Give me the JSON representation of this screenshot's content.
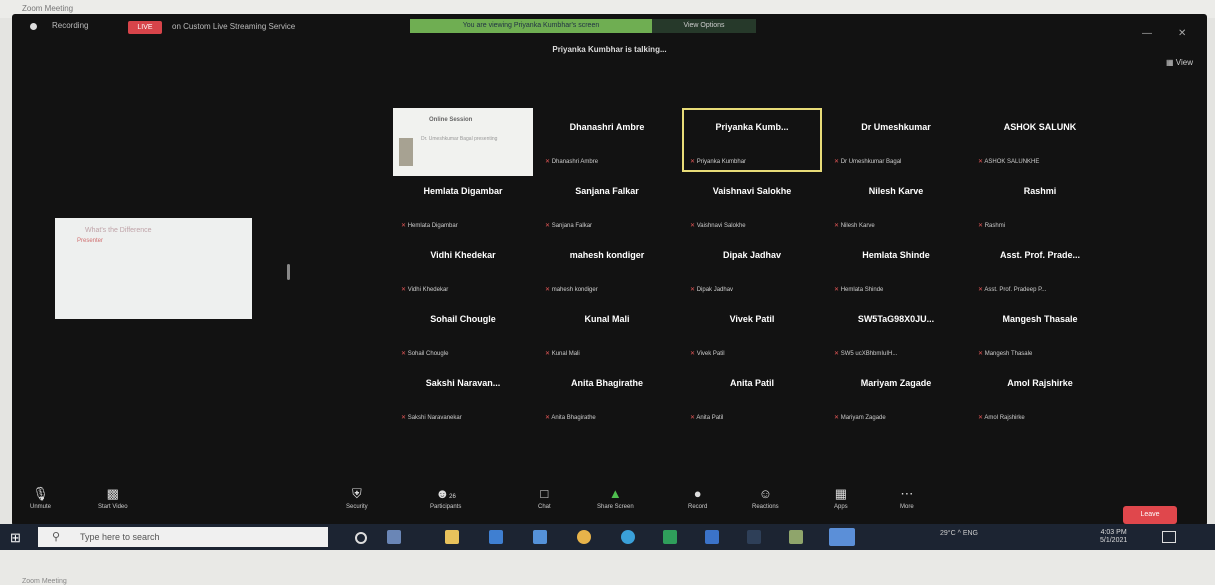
{
  "window": {
    "title": "Zoom Meeting",
    "bottom_title": "Zoom Meeting"
  },
  "topbar": {
    "recording": "Recording",
    "live_badge": "LIVE",
    "stream_label": "on Custom Live Streaming Service",
    "share_banner": "You are viewing Priyanka Kumbhar's screen",
    "view_options": "View Options"
  },
  "talking": "Priyanka Kumbhar is talking...",
  "view_toggle": "View",
  "shared": {
    "caption": "What's the Difference",
    "sub": "Presenter"
  },
  "video_tile": {
    "title": "Online Session",
    "sub": "Dr. Umeshkumar Bagal presenting"
  },
  "participants": [
    {
      "name": "Dhanashri Ambre",
      "label": "Dhanashri Ambre"
    },
    {
      "name": "Priyanka Kumb...",
      "label": "Priyanka Kumbhar"
    },
    {
      "name": "Dr Umeshkumar",
      "label": "Dr Umeshkumar Bagal"
    },
    {
      "name": "ASHOK SALUNK",
      "label": "ASHOK SALUNKHE"
    },
    {
      "name": "Hemlata Digambar",
      "label": "Hemlata Digambar"
    },
    {
      "name": "Sanjana Falkar",
      "label": "Sanjana Falkar"
    },
    {
      "name": "Vaishnavi Salokhe",
      "label": "Vaishnavi Salokhe"
    },
    {
      "name": "Nilesh Karve",
      "label": "Nilesh Karve"
    },
    {
      "name": "Rashmi",
      "label": "Rashmi"
    },
    {
      "name": "Vidhi Khedekar",
      "label": "Vidhi Khedekar"
    },
    {
      "name": "mahesh kondiger",
      "label": "mahesh kondiger"
    },
    {
      "name": "Dipak Jadhav",
      "label": "Dipak Jadhav"
    },
    {
      "name": "Hemlata Shinde",
      "label": "Hemlata Shinde"
    },
    {
      "name": "Asst. Prof. Prade...",
      "label": "Asst. Prof. Pradeep P..."
    },
    {
      "name": "Sohail Chougle",
      "label": "Sohail Chougle"
    },
    {
      "name": "Kunal Mali",
      "label": "Kunal Mali"
    },
    {
      "name": "Vivek Patil",
      "label": "Vivek Patil"
    },
    {
      "name": "SW5TaG98X0JU...",
      "label": "SW5 ucXBhbmIuIH..."
    },
    {
      "name": "Mangesh Thasale",
      "label": "Mangesh Thasale"
    },
    {
      "name": "Sakshi Naravan...",
      "label": "Sakshi Naravanekar"
    },
    {
      "name": "Anita Bhagirathe",
      "label": "Anita Bhagirathe"
    },
    {
      "name": "Anita Patil",
      "label": "Anita Patil"
    },
    {
      "name": "Mariyam Zagade",
      "label": "Mariyam Zagade"
    },
    {
      "name": "Amol Rajshirke",
      "label": "Amol Rajshirke"
    }
  ],
  "controls": {
    "unmute": "Unmute",
    "start_video": "Start Video",
    "security": "Security",
    "participants": "Participants",
    "participants_count": "26",
    "chat": "Chat",
    "share_screen": "Share Screen",
    "record": "Record",
    "reactions": "Reactions",
    "apps": "Apps",
    "more": "More",
    "end": "Leave"
  },
  "taskbar": {
    "search_placeholder": "Type here to search",
    "tray": "29°C  ^  ENG",
    "time": "4:03 PM",
    "date": "5/1/2021"
  },
  "colors": {
    "active_border": "#e8dc78",
    "end": "#e0474c",
    "banner": "#6fae52"
  }
}
